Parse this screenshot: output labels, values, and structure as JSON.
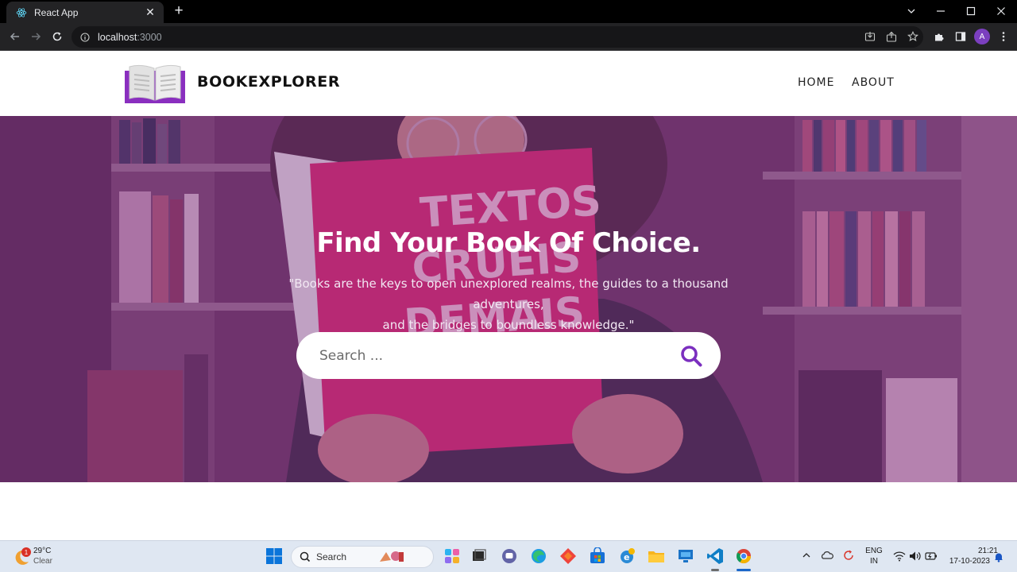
{
  "browser": {
    "tab_title": "React App",
    "url_host": "localhost",
    "url_port": ":3000",
    "profile_initial": "A"
  },
  "site": {
    "brand": "BOOKEXPLORER",
    "nav": [
      {
        "label": "HOME"
      },
      {
        "label": "ABOUT"
      }
    ],
    "accent_color": "#7b2fbf"
  },
  "hero": {
    "title": "Find Your Book Of Choice.",
    "quote_line1": "\"Books are the keys to open unexplored realms, the guides to a thousand adventures,",
    "quote_line2": "and the bridges to boundless knowledge.\"",
    "search_placeholder": "Search ..."
  },
  "taskbar": {
    "weather_temp": "29°C",
    "weather_cond": "Clear",
    "weather_badge": "1",
    "search_label": "Search",
    "lang_line1": "ENG",
    "lang_line2": "IN",
    "time": "21:21",
    "date": "17-10-2023"
  }
}
